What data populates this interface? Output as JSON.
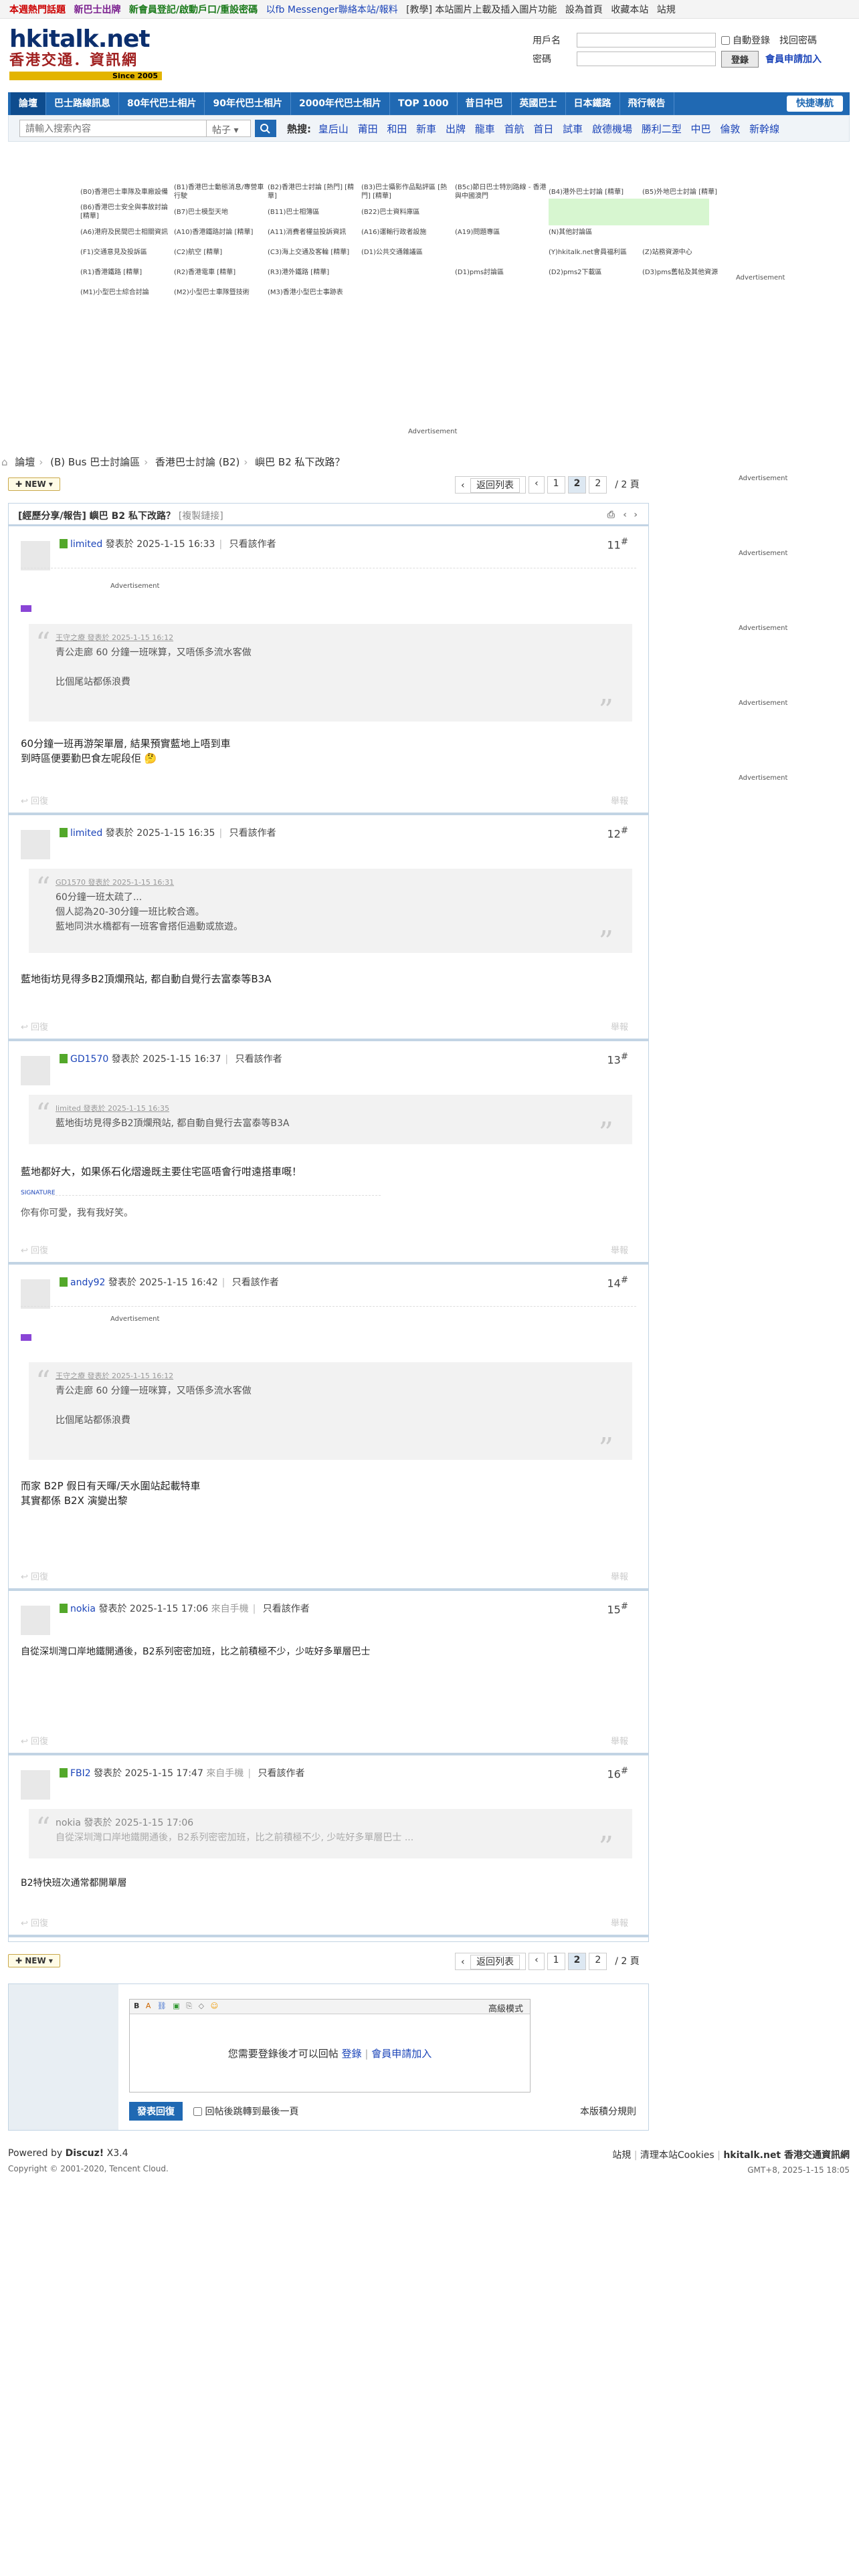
{
  "topbar": {
    "items": [
      "本週熱門話題",
      "新巴士出牌",
      "新會員登記/啟動戶口/重設密碼",
      "以fb Messenger聯絡本站/報料",
      "[教學] 本站圖片上載及插入圖片功能",
      "設為首頁",
      "收藏本站",
      "站規"
    ]
  },
  "logo": {
    "line1": "hkitalk.net",
    "line2": "香港交通．資訊網",
    "since": "Since 2005"
  },
  "login": {
    "user_label": "用戶名",
    "pass_label": "密碼",
    "auto_login": "自動登錄",
    "forgot": "找回密碼",
    "login_btn": "登錄",
    "register": "會員申請加入"
  },
  "nav": {
    "items": [
      "論壇",
      "巴士路線訊息",
      "80年代巴士相片",
      "90年代巴士相片",
      "2000年代巴士相片",
      "TOP 1000",
      "昔日中巴",
      "英國巴士",
      "日本鐵路",
      "飛行報告"
    ],
    "quick": "快捷導航"
  },
  "search": {
    "placeholder": "請輸入搜索內容",
    "type": "帖子",
    "hot_label": "熱搜:",
    "hot": [
      "皇后山",
      "莆田",
      "和田",
      "新車",
      "出牌",
      "龍車",
      "首航",
      "首日",
      "試車",
      "啟德機場",
      "勝利二型",
      "中巴",
      "倫敦",
      "新幹線"
    ]
  },
  "forum_grid": [
    [
      "(B0)香港巴士車隊及車廠設備",
      "(B1)香港巴士動態消息/專營車行駛",
      "(B2)香港巴士討論 [熱門] [精華]",
      "(B3)巴士攝影作品點評區 [熱門] [精華]",
      "(B5c)節日巴士特別路線 - 香港與中國澳門",
      "(B4)港外巴士討論 [精華]",
      "(B5)外地巴士討論 [精華]"
    ],
    [
      "(B6)香港巴士安全與事故討論 [精華]",
      "(B7)巴士模型天地",
      "(B11)巴士相簿區",
      "(B22)巴士資料庫區"
    ],
    [
      "(A6)港府及民間巴士相關資訊",
      "(A10)香港鐵路討論 [精華]",
      "(A11)消費者權益投訴資訊",
      "(A16)運輸行政者設施",
      "(A19)問題專區",
      "(N)其他討論區"
    ],
    [
      "(F1)交通意見及投訴區",
      "(C2)航空 [精華]",
      "(C3)海上交通及客輪 [精華]",
      "(D1)公共交通雜議區",
      "",
      "(Y)hkitalk.net會員福利區",
      "(Z)站務資源中心"
    ],
    [
      "(R1)香港鐵路 [精華]",
      "(R2)香港電車 [精華]",
      "(R3)港外鐵路 [精華]",
      "",
      "(D1)pms討論區",
      "(D2)pms2下載區",
      "(D3)pms舊帖及其他資源"
    ],
    [
      "(M1)小型巴士綜合討論",
      "(M2)小型巴士車隊暨技術",
      "(M3)香港小型巴士事跡表"
    ]
  ],
  "ads": {
    "label": "Advertisement"
  },
  "breadcrumb": [
    "論壇",
    "(B) Bus 巴士討論區",
    "香港巴士討論 (B2)",
    "嶼巴 B2 私下改路？"
  ],
  "pager": {
    "new": "NEW",
    "back": "返回列表",
    "pages": [
      "1",
      "2"
    ],
    "current": "2",
    "total": "/ 2 頁"
  },
  "thread": {
    "prefix": "[經歷分享/報告]",
    "title": "嶼巴 B2 私下改路？",
    "copy": "[複製鏈接]"
  },
  "posts": [
    {
      "user": "limited",
      "time": "發表於 2025-1-15 16:33",
      "only": "只看該作者",
      "no": "11",
      "quote_head": "王守之療 發表於 2025-1-15 16:12",
      "quote": [
        "青公走廊 60 分鐘一班咪算，又唔係多流水客做",
        "",
        "比個尾站都係浪費"
      ],
      "body": [
        "60分鐘一班再游架單層, 結果預實藍地上唔到車",
        "到時區便要勤巴食左呢段佢 🤔"
      ]
    },
    {
      "user": "limited",
      "time": "發表於 2025-1-15 16:35",
      "only": "只看該作者",
      "no": "12",
      "quote_head": "GD1570 發表於 2025-1-15 16:31",
      "quote": [
        "60分鐘一班太疏了...",
        "個人認為20-30分鐘一班比較合適。",
        "藍地同洪水橋都有一班客會搭佢過動或旅遊。"
      ],
      "body": [
        "藍地街坊見得多B2頂爛飛站, 都自動自覺行去富泰等B3A"
      ]
    },
    {
      "user": "GD1570",
      "time": "發表於 2025-1-15 16:37",
      "only": "只看該作者",
      "no": "13",
      "quote_head": "limited 發表於 2025-1-15 16:35",
      "quote": [
        "藍地街坊見得多B2頂爛飛站, 都自動自覺行去富泰等B3A"
      ],
      "body": [
        "藍地都好大，如果係石化熠邊既主要住宅區唔會行咁遠搭車嘅！"
      ],
      "sig_label": "SIGNATURE",
      "sig": "你有你可愛，我有我好笑。"
    },
    {
      "user": "andy92",
      "time": "發表於 2025-1-15 16:42",
      "only": "只看該作者",
      "no": "14",
      "quote_head": "王守之療 發表於 2025-1-15 16:12",
      "quote": [
        "青公走廊 60 分鐘一班咪算，又唔係多流水客做",
        "",
        "比個尾站都係浪費"
      ],
      "body": [
        "而家 B2P 假日有天暉/天水圍站起載特車",
        "其實都係 B2X 演變出黎"
      ]
    },
    {
      "user": "nokia",
      "time": "發表於 2025-1-15 17:06",
      "mobile": "來自手機",
      "only": "只看該作者",
      "no": "15",
      "body": [
        "自從深圳灣口岸地鐵開通後，B2系列密密加班，比之前積極不少，少咗好多單層巴士"
      ]
    },
    {
      "user": "FBI2",
      "time": "發表於 2025-1-15 17:47",
      "mobile": "來自手機",
      "only": "只看該作者",
      "no": "16",
      "quote_head": "nokia 發表於 2025-1-15 17:06",
      "quote": [
        "自從深圳灣口岸地鐵開通後，B2系列密密加班，比之前積極不少, 少咗好多單層巴士 ..."
      ],
      "body": [
        "B2特快班次通常都開單層"
      ]
    }
  ],
  "actions": {
    "reply": "回復",
    "report": "舉報"
  },
  "replybox": {
    "advanced": "高級模式",
    "need_login": "您需要登錄後才可以回帖",
    "login": "登錄",
    "sep": "|",
    "register": "會員申請加入",
    "post_btn": "發表回復",
    "jump": "回帖後跳轉到最後一頁",
    "rules": "本版積分規則"
  },
  "footer": {
    "powered": "Powered by",
    "brand": "Discuz!",
    "ver": "X3.4",
    "copyright": "Copyright © 2001-2020, Tencent Cloud.",
    "links": [
      "站規",
      "清理本站Cookies",
      "hkitalk.net 香港交通資訊網"
    ],
    "time": "GMT+8, 2025-1-15 18:05"
  }
}
